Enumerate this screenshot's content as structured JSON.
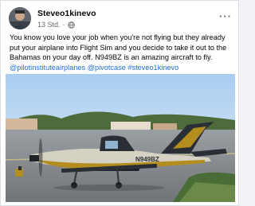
{
  "post": {
    "author": "Steveo1kinevo",
    "time": "13 Std.",
    "separator": "·",
    "more_label": "···",
    "text": "You know you love your job when you're not flying but they already put your airplane into Flight Sim and you decide to take it out to the Bahamas on your day off.  N949BZ is an amazing aircraft to fly.",
    "hashtags": "@pilotinstituteairplanes @pivotcase #steveo1kinevo"
  },
  "photo": {
    "tail_registration": "N949BZ"
  },
  "icons": {
    "privacy": "globe-icon",
    "menu": "more-icon"
  },
  "colors": {
    "link": "#216fdb",
    "aircraft_gold": "#b48d1f",
    "aircraft_dark": "#2a2f36"
  }
}
